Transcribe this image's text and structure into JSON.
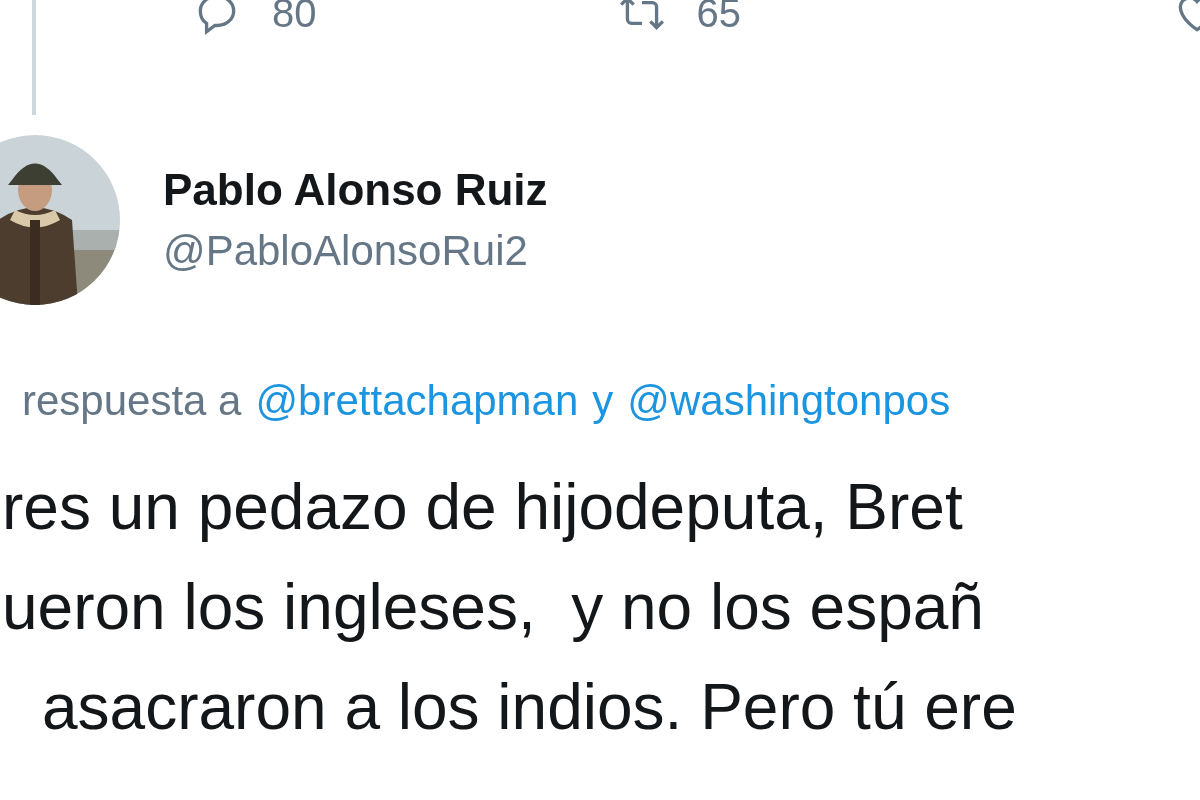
{
  "actions": [
    {
      "kind": "reply",
      "count": "80"
    },
    {
      "kind": "retweet",
      "count": "65"
    },
    {
      "kind": "like"
    }
  ],
  "author": {
    "name": "Pablo Alonso Ruiz",
    "handle": "@PabloAlonsoRui2"
  },
  "reply_to": {
    "prefix": "respuesta a",
    "mentions": [
      "@brettachapman",
      "@washingtonpos"
    ],
    "joiner": "y"
  },
  "body_lines": [
    "res un pedazo de hijodeputa, Bret",
    "ueron los ingleses,  y no los españ",
    "asacraron a los indios. Pero tú ere"
  ]
}
